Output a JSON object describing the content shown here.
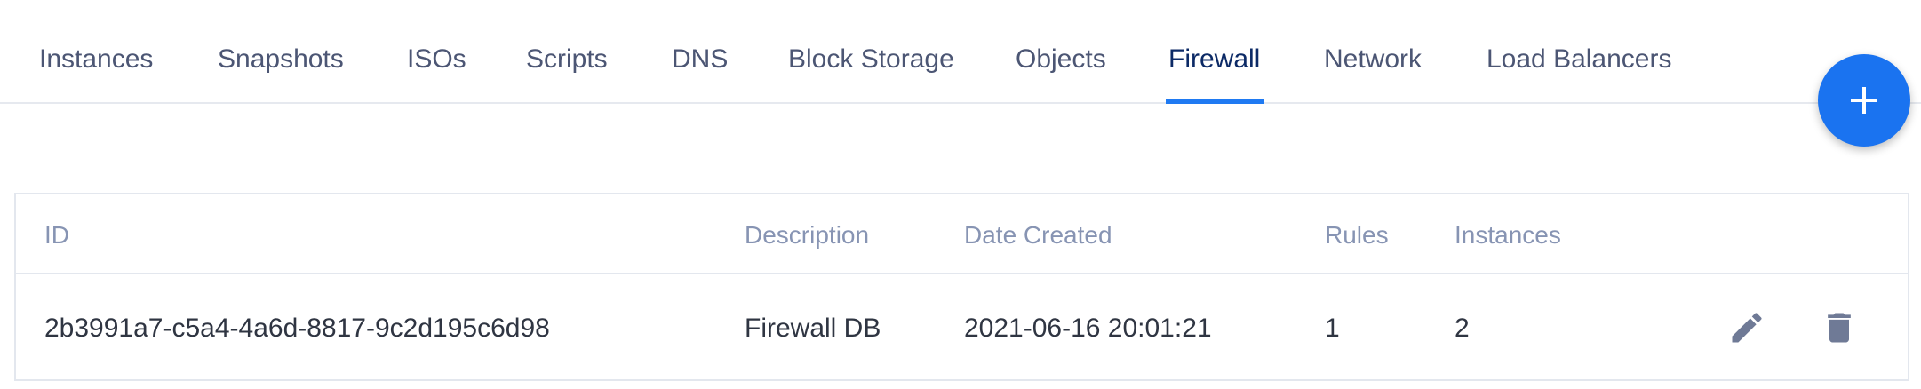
{
  "tabs": [
    {
      "label": "Instances"
    },
    {
      "label": "Snapshots"
    },
    {
      "label": "ISOs"
    },
    {
      "label": "Scripts"
    },
    {
      "label": "DNS"
    },
    {
      "label": "Block Storage"
    },
    {
      "label": "Objects"
    },
    {
      "label": "Firewall",
      "active": true
    },
    {
      "label": "Network"
    },
    {
      "label": "Load Balancers"
    }
  ],
  "fab": {
    "icon": "plus-icon",
    "color": "#1a73f0"
  },
  "table": {
    "headers": [
      "ID",
      "Description",
      "Date Created",
      "Rules",
      "Instances"
    ],
    "rows": [
      {
        "id": "2b3991a7-c5a4-4a6d-8817-9c2d195c6d98",
        "description": "Firewall DB",
        "date_created": "2021-06-16 20:01:21",
        "rules": "1",
        "instances": "2",
        "actions": [
          "pencil-icon",
          "trash-icon"
        ]
      }
    ]
  },
  "colors": {
    "accent": "#1f7af2",
    "header_text": "#8794b3",
    "tab_text": "#4c5674",
    "active_tab_text": "#0c2a66"
  }
}
